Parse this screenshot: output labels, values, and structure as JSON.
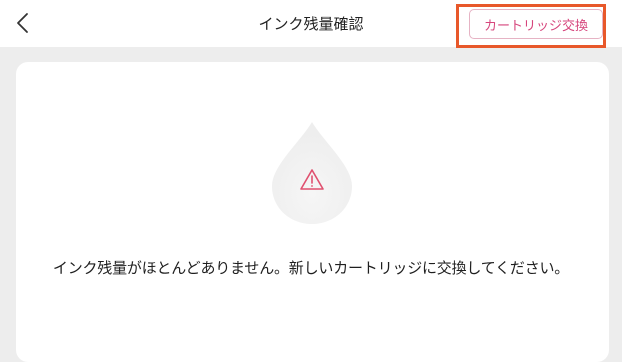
{
  "header": {
    "title": "インク残量確認",
    "back_icon": "chevron-left-icon",
    "replace_button_label": "カートリッジ交換"
  },
  "status": {
    "icon": "warning-icon",
    "message": "インク残量がほとんどありません。新しいカートリッジに交換してください。"
  },
  "colors": {
    "accent": "#d6457c",
    "highlight": "#e8582a",
    "background": "#ededed",
    "drop": "#f3f3f3"
  }
}
